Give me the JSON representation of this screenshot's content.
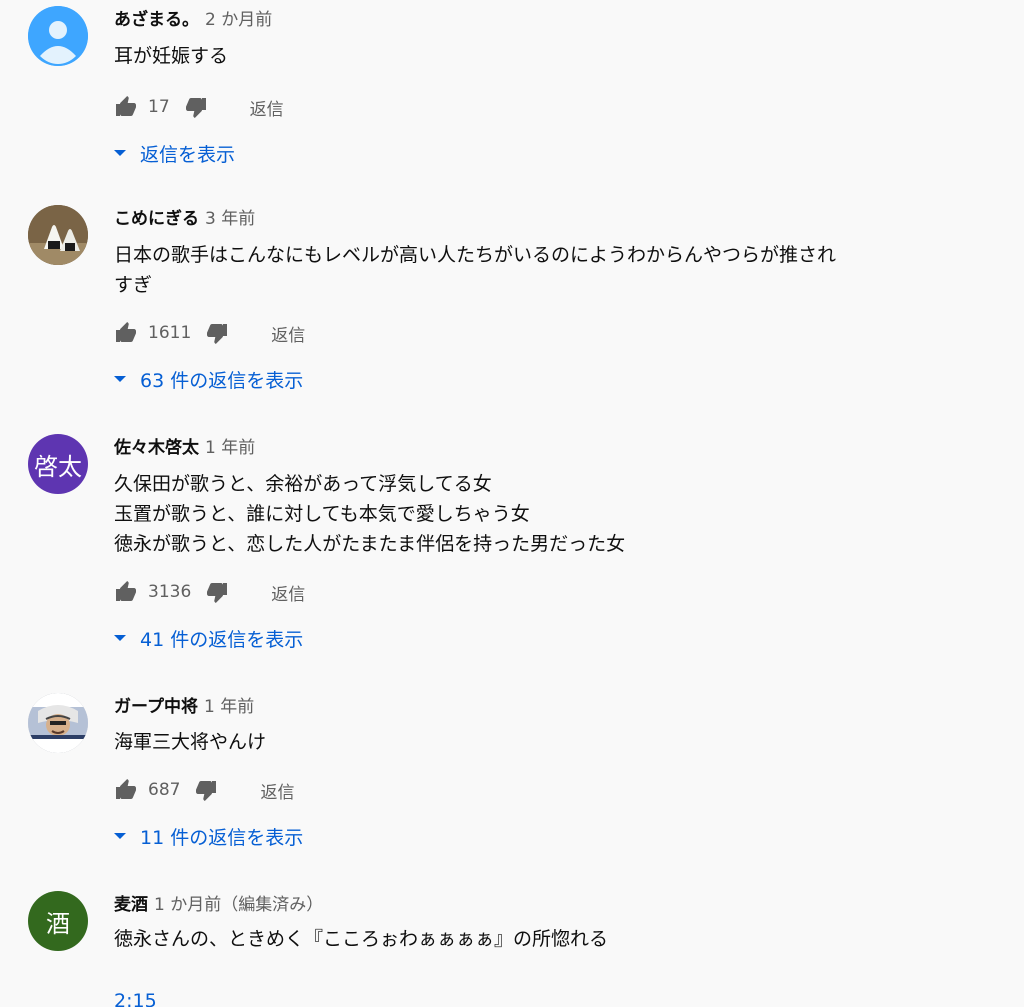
{
  "comments": [
    {
      "author": "あざまる。",
      "time": "2 か月前",
      "text": [
        "耳が妊娠する"
      ],
      "likes": "17",
      "reply_label": "返信",
      "replies_toggle": "返信を表示",
      "avatar": {
        "type": "default-user-icon",
        "color": "#3ea6ff"
      }
    },
    {
      "author": "こめにぎる",
      "time": "3 年前",
      "text": [
        "日本の歌手はこんなにもレベルが高い人たちがいるのにようわからんやつらが推され",
        "すぎ"
      ],
      "likes": "1611",
      "reply_label": "返信",
      "replies_toggle": "63 件の返信を表示",
      "avatar": {
        "type": "onigiri-photo-icon",
        "color": "#6b5a3e"
      }
    },
    {
      "author": "佐々木啓太",
      "time": "1 年前",
      "text": [
        "久保田が歌うと、余裕があって浮気してる女",
        "玉置が歌うと、誰に対しても本気で愛しちゃう女",
        "徳永が歌うと、恋した人がたまたま伴侶を持った男だった女"
      ],
      "likes": "3136",
      "reply_label": "返信",
      "replies_toggle": "41 件の返信を表示",
      "avatar": {
        "type": "letter",
        "letter": "啓太",
        "color": "#5e35b1"
      }
    },
    {
      "author": "ガープ中将",
      "time": "1 年前",
      "text": [
        "海軍三大将やんけ"
      ],
      "likes": "687",
      "reply_label": "返信",
      "replies_toggle": "11 件の返信を表示",
      "avatar": {
        "type": "anime-character-icon",
        "color": "#8a8f9c"
      }
    },
    {
      "author": "麦酒",
      "time": "1 か月前（編集済み）",
      "text": [
        "徳永さんの、ときめく『こころぉわぁぁぁぁ』の所惚れる"
      ],
      "avatar": {
        "type": "letter",
        "letter": "酒",
        "color": "#33691e"
      }
    }
  ],
  "timestamp_link": "2:15",
  "colors": {
    "link": "#065fd4",
    "meta": "#606060",
    "text": "#0f0f0f",
    "background": "#f9f9f9"
  }
}
